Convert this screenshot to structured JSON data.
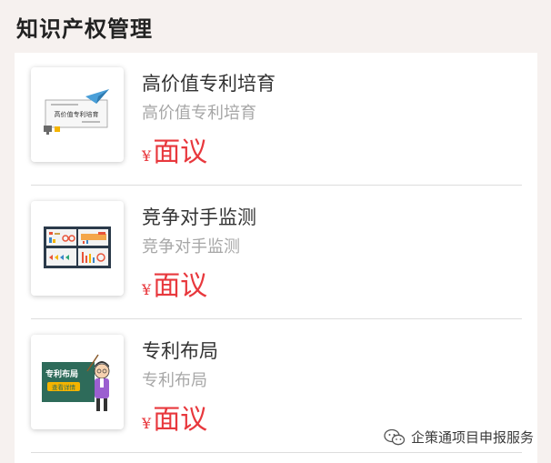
{
  "page": {
    "title": "知识产权管理"
  },
  "items": [
    {
      "title": "高价值专利培育",
      "subtitle": "高价值专利培育",
      "currency": "¥",
      "price": "面议",
      "thumbnail": {
        "icon": "paper-plane-screen-illustration",
        "caption": "高价值专利培育"
      }
    },
    {
      "title": "竞争对手监测",
      "subtitle": "竞争对手监测",
      "currency": "¥",
      "price": "面议",
      "thumbnail": {
        "icon": "dashboard-charts-illustration"
      }
    },
    {
      "title": "专利布局",
      "subtitle": "专利布局",
      "currency": "¥",
      "price": "面议",
      "thumbnail": {
        "icon": "teacher-blackboard-illustration",
        "board_text": "专利布局",
        "button_text": "查看详情"
      }
    }
  ],
  "watermark": {
    "icon": "wechat-icon",
    "text": "企策通项目申报服务"
  },
  "colors": {
    "price": "#e8383d",
    "background": "#f6f1ef",
    "board": "#2e6b5a"
  }
}
